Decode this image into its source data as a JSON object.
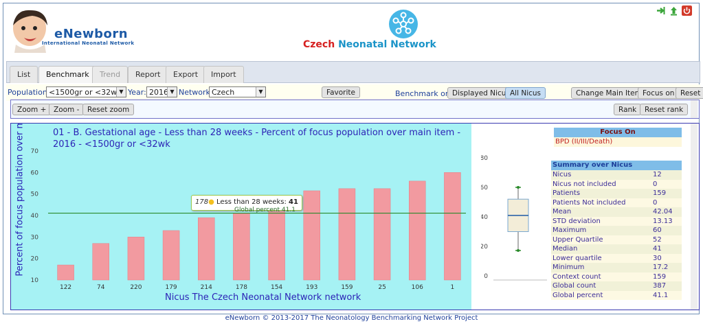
{
  "brand": {
    "name": "eNewborn",
    "subtitle": "International Neonatal Network"
  },
  "network_title": {
    "part1": "Czech",
    "part2": "Neonatal Network"
  },
  "top_icons": [
    "logout-icon",
    "upload-icon",
    "power-icon"
  ],
  "tabs": [
    {
      "label": "List",
      "state": "normal"
    },
    {
      "label": "Benchmark",
      "state": "active"
    },
    {
      "label": "Trend",
      "state": "disabled"
    },
    {
      "label": "Report",
      "state": "normal"
    },
    {
      "label": "Export",
      "state": "normal"
    },
    {
      "label": "Import",
      "state": "normal"
    }
  ],
  "filters": {
    "population_label": "Population:",
    "population_value": "<1500gr or <32wk",
    "year_label": "Year:",
    "year_value": "2016",
    "network_label": "Network:",
    "network_value": "Czech",
    "favorite": "Favorite",
    "benchmark_on": "Benchmark on",
    "displayed_nicu": "Displayed Nicu",
    "all_nicus": "All Nicus",
    "change_main_item": "Change Main Item",
    "focus_on": "Focus on",
    "reset": "Reset"
  },
  "zoom": {
    "zoom_in": "Zoom +",
    "zoom_out": "Zoom -",
    "reset_zoom": "Reset zoom",
    "rank": "Rank",
    "reset_rank": "Reset rank"
  },
  "chart_data": {
    "type": "bar",
    "title": "01 - B. Gestational age - Less than 28 weeks - Percent of focus population over main item - 2016 - <1500gr or <32wk",
    "xlabel": "Nicus The Czech Neonatal Network network",
    "ylabel": "Percent of focus population over main item",
    "categories": [
      "122",
      "74",
      "220",
      "179",
      "214",
      "178",
      "154",
      "193",
      "159",
      "25",
      "106",
      "1"
    ],
    "values": [
      17,
      27,
      30,
      33,
      39,
      41,
      49,
      51.5,
      52.5,
      52.5,
      56,
      60
    ],
    "ylim": [
      10,
      70
    ],
    "yticks": [
      10,
      20,
      30,
      40,
      50,
      60,
      70
    ],
    "bar_color": "#f29aa0",
    "global_line": {
      "label": "Global percent 41.1",
      "value": 41.1,
      "color": "#2a8a2a"
    },
    "tooltip": {
      "nicu": "178",
      "text": "Less than 28 weeks:",
      "value": "41"
    },
    "boxplot": {
      "yticks": [
        0,
        20,
        40,
        60,
        80
      ],
      "min": 17.2,
      "q1": 30,
      "median": 41,
      "q3": 52,
      "max": 60,
      "ylim": [
        0,
        80
      ]
    }
  },
  "focus": {
    "title": "Focus On",
    "value": "BPD (II/III/Death)"
  },
  "summary": {
    "title": "Summary over Nicus",
    "rows": [
      {
        "k": "Nicus",
        "v": "12"
      },
      {
        "k": "Nicus not included",
        "v": "0"
      },
      {
        "k": "Patients",
        "v": "159"
      },
      {
        "k": "Patients Not included",
        "v": "0"
      },
      {
        "k": "Mean",
        "v": "42.04"
      },
      {
        "k": "STD deviation",
        "v": "13.13"
      },
      {
        "k": "Maximum",
        "v": "60"
      },
      {
        "k": "Upper Quartile",
        "v": "52"
      },
      {
        "k": "Median",
        "v": "41"
      },
      {
        "k": "Lower quartile",
        "v": "30"
      },
      {
        "k": "Minimum",
        "v": "17.2"
      },
      {
        "k": "Context count",
        "v": "159"
      },
      {
        "k": "Global count",
        "v": "387"
      },
      {
        "k": "Global percent",
        "v": "41.1"
      }
    ]
  },
  "footer": "eNewborn © 2013-2017 The Neonatology Benchmarking Network Project"
}
